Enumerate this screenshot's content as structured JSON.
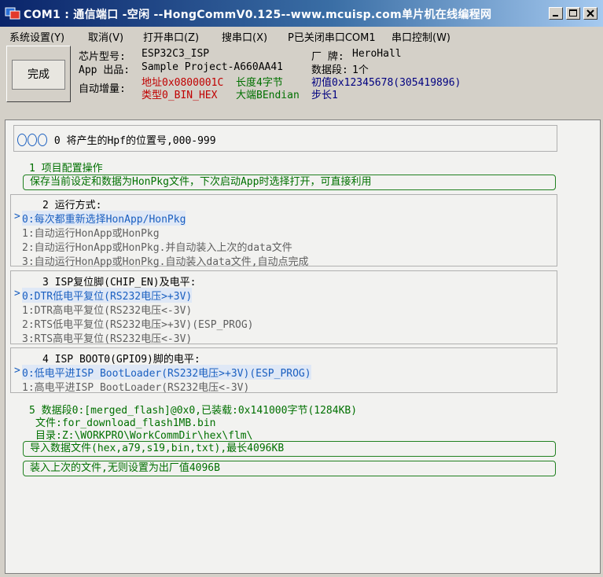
{
  "window": {
    "title": "COM1 : 通信端口 -空闲  --HongCommV0.125--www.mcuisp.com单片机在线编程网",
    "buttons": [
      "minimize",
      "maximize",
      "close"
    ]
  },
  "menu": [
    "系统设置(Y)",
    "取消(V)",
    "打开串口(Z)",
    "搜串口(X)",
    "P已关闭串口COM1",
    "串口控制(W)"
  ],
  "header": {
    "done_label": "完成",
    "chip_label": "芯片型号:",
    "chip_value": "ESP32C3_ISP",
    "vendor_label": "厂  牌:",
    "vendor_value": "HeroHall",
    "app_label": "App 出品:",
    "app_value": "Sample Project-A660AA41",
    "segments_label": "数据段:",
    "segments_value": "1个",
    "auto_inc_label": "自动增量:",
    "addr_text": "地址0x0800001C",
    "length_text": "长度4字节",
    "init_text": "初值0x12345678(305419896)",
    "type_text": "类型0_BIN_HEX",
    "endian_text": "大端BEndian",
    "step_text": "步长1"
  },
  "main": {
    "position_line": "0 将产生的Hpf的位置号,000-999",
    "sect1_title": "1 项目配置操作",
    "sect1_button": "保存当前设定和数据为HonPkg文件，下次启动App时选择打开，可直接利用",
    "sect2_title": "2 运行方式:",
    "sect2_options": [
      "0:每次都重新选择HonApp/HonPkg",
      "1:自动运行HonApp或HonPkg",
      "2:自动运行HonApp或HonPkg.并自动装入上次的data文件",
      "3:自动运行HonApp或HonPkg.自动装入data文件,自动点完成"
    ],
    "sect3_title": "3 ISP复位脚(CHIP_EN)及电平:",
    "sect3_options": [
      "0:DTR低电平复位(RS232电压>+3V)",
      "1:DTR高电平复位(RS232电压<-3V)",
      "2:RTS低电平复位(RS232电压>+3V)(ESP_PROG)",
      "3:RTS高电平复位(RS232电压<-3V)"
    ],
    "sect4_title": "4 ISP BOOT0(GPIO9)脚的电平:",
    "sect4_options": [
      "0:低电平进ISP BootLoader(RS232电压>+3V)(ESP_PROG)",
      "1:高电平进ISP BootLoader(RS232电压<-3V)"
    ],
    "sect5_title": "5 数据段0:[merged_flash]@0x0,已装载:0x141000字节(1284KB)",
    "sect5_file": "文件:for_download_flash1MB.bin",
    "sect5_dir": "目录:Z:\\WORKPRO\\WorkCommDir\\hex\\flm\\",
    "sect5_button1": "导入数据文件(hex,a79,s19,bin,txt),最长4096KB",
    "sect5_button2": "装入上次的文件,无则设置为出厂值4096B",
    "selected_marker": ">"
  }
}
